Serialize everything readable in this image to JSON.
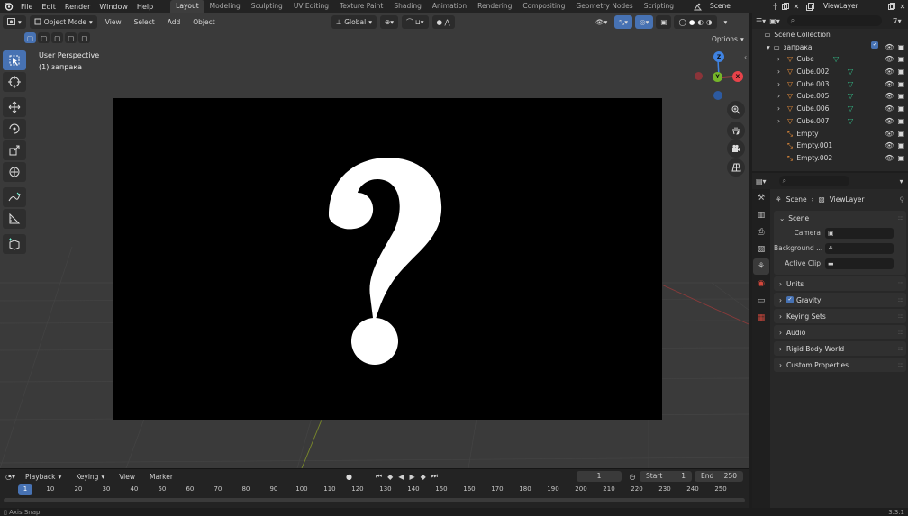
{
  "app": {
    "menus": [
      "File",
      "Edit",
      "Render",
      "Window",
      "Help"
    ],
    "workspaces": [
      "Layout",
      "Modeling",
      "Sculpting",
      "UV Editing",
      "Texture Paint",
      "Shading",
      "Animation",
      "Rendering",
      "Compositing",
      "Geometry Nodes",
      "Scripting"
    ],
    "active_workspace": "Layout",
    "scene_name": "Scene",
    "view_layer": "ViewLayer"
  },
  "viewport": {
    "mode": "Object Mode",
    "menus": [
      "View",
      "Select",
      "Add",
      "Object"
    ],
    "transform_orientation": "Global",
    "options_label": "Options",
    "perspective_label": "User Perspective",
    "object_label": "(1) запрака",
    "image_glyph": "?",
    "gizmo_axes": {
      "x": "X",
      "y": "Y",
      "z": "Z"
    },
    "tools": [
      "select-box",
      "cursor",
      "move",
      "rotate",
      "scale",
      "transform",
      "annotate",
      "measure",
      "add-cube"
    ]
  },
  "timeline": {
    "menus": [
      "Playback",
      "Keying",
      "View",
      "Marker"
    ],
    "current_frame": "1",
    "start_label": "Start",
    "start_value": "1",
    "end_label": "End",
    "end_value": "250",
    "ruler_ticks": [
      "1",
      "10",
      "20",
      "30",
      "40",
      "50",
      "60",
      "70",
      "80",
      "90",
      "100",
      "110",
      "120",
      "130",
      "140",
      "150",
      "160",
      "170",
      "180",
      "190",
      "200",
      "210",
      "220",
      "230",
      "240",
      "250"
    ]
  },
  "statusbar": {
    "left": "Axis Snap",
    "version": "3.3.1"
  },
  "outliner": {
    "root": "Scene Collection",
    "collection": "запрака",
    "items": [
      {
        "name": "Cube",
        "type": "mesh",
        "expandable": true
      },
      {
        "name": "Cube.002",
        "type": "mesh",
        "expandable": true
      },
      {
        "name": "Cube.003",
        "type": "mesh",
        "expandable": true
      },
      {
        "name": "Cube.005",
        "type": "mesh",
        "expandable": true
      },
      {
        "name": "Cube.006",
        "type": "mesh",
        "expandable": true
      },
      {
        "name": "Cube.007",
        "type": "mesh",
        "expandable": true
      },
      {
        "name": "Empty",
        "type": "empty",
        "expandable": false
      },
      {
        "name": "Empty.001",
        "type": "empty",
        "expandable": false
      },
      {
        "name": "Empty.002",
        "type": "empty",
        "expandable": false
      }
    ]
  },
  "properties": {
    "breadcrumb": [
      "Scene",
      "ViewLayer"
    ],
    "scene_panel": {
      "title": "Scene",
      "fields": [
        {
          "label": "Camera",
          "value": ""
        },
        {
          "label": "Background ...",
          "value": ""
        },
        {
          "label": "Active Clip",
          "value": ""
        }
      ]
    },
    "collapsed_panels": [
      "Units",
      "Gravity",
      "Keying Sets",
      "Audio",
      "Rigid Body World",
      "Custom Properties"
    ],
    "gravity_checked": true
  },
  "colors": {
    "accent": "#4772b3",
    "mesh_icon": "#ff9a3c",
    "modifier_icon": "#33c08b",
    "axis_x": "#e8434a",
    "axis_y": "#75b62a",
    "axis_z": "#3f83e2"
  }
}
